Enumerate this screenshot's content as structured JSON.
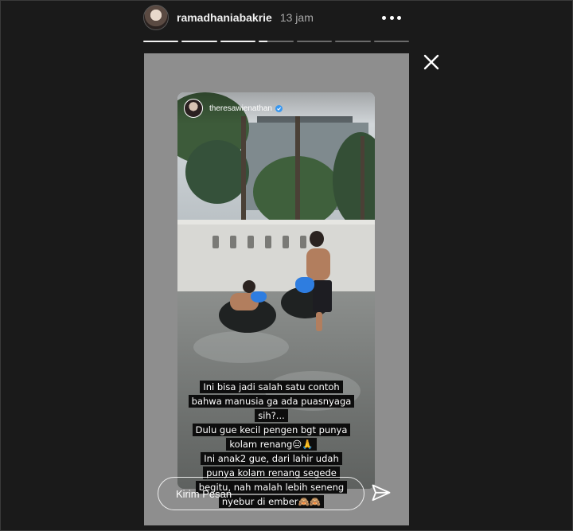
{
  "header": {
    "username": "ramadhaniabakrie",
    "time_ago": "13 jam",
    "more_icon": "more-horizontal-icon"
  },
  "progress": {
    "segments": [
      1,
      1,
      1,
      0.25,
      0,
      0,
      0
    ]
  },
  "close_icon": "close-icon",
  "story": {
    "repost_username": "theresawienathan",
    "verified_icon": "verified-badge-icon",
    "caption_lines": [
      "Ini bisa jadi salah satu contoh",
      "bahwa manusia ga ada puasnyaga",
      "sih?...",
      "Dulu gue kecil pengen bgt punya",
      "kolam renang😑🙏",
      "Ini anak2 gue, dari lahir udah",
      "punya kolam renang segede",
      "begitu, nah malah lebih seneng",
      "nyebur di ember🙈🙈"
    ]
  },
  "reply": {
    "placeholder": "Kirim Pesan",
    "send_icon": "send-icon"
  },
  "colors": {
    "background": "#1a1a1a",
    "accent_verified": "#3897f0",
    "text_primary": "#f2f2f2",
    "text_secondary": "#a8a8a8"
  }
}
